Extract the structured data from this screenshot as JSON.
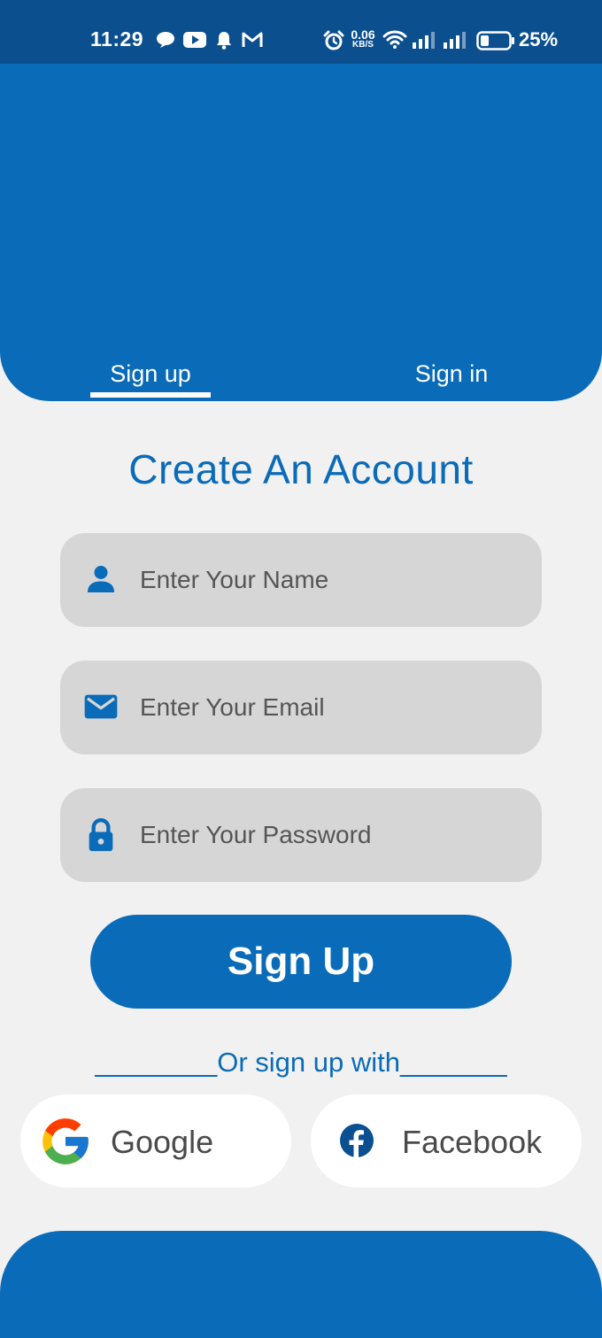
{
  "status_bar": {
    "time": "11:29",
    "net_speed_value": "0.06",
    "net_speed_unit": "KB/S",
    "battery": "25%"
  },
  "tabs": {
    "signup_label": "Sign up",
    "signin_label": "Sign in",
    "active": "signup"
  },
  "title": "Create An Account",
  "fields": {
    "name_placeholder": "Enter Your Name",
    "email_placeholder": "Enter Your Email",
    "password_placeholder": "Enter Your Password"
  },
  "signup_button_label": "Sign Up",
  "divider_text": "________Or sign up with_______",
  "social": {
    "google_label": "Google",
    "facebook_label": "Facebook"
  },
  "colors": {
    "primary": "#0a6bb8",
    "status_bar": "#0b4f8f",
    "background": "#f1f1f1",
    "field_bg": "#d6d6d6"
  },
  "icons": {
    "name_field": "person-icon",
    "email_field": "mail-icon",
    "password_field": "lock-icon",
    "google": "google-icon",
    "facebook": "facebook-icon"
  }
}
